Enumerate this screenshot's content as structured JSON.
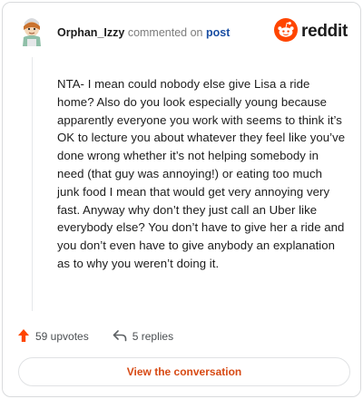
{
  "header": {
    "username": "Orphan_Izzy",
    "action_text": "commented on",
    "post_link": "post",
    "brand_word": "reddit"
  },
  "comment": {
    "text": "NTA- I mean could nobody else give Lisa a ride home? Also do you look especially young because apparently everyone you work with seems to think it’s OK to lecture you about whatever they feel like you’ve done wrong whether it’s not helping somebody in need (that guy was annoying!) or eating too much junk food I mean that would get very annoying very fast. Anyway why don’t they just call an Uber like everybody else? You don’t have to give her a ride and you don’t even have to give anybody an explanation as to why you weren’t doing it."
  },
  "footer": {
    "upvotes_label": "59 upvotes",
    "replies_label": "5 replies",
    "cta_label": "View the conversation"
  },
  "colors": {
    "brand_orange": "#ff4500",
    "link_blue": "#1a4ea3",
    "cta_orange": "#d74a14"
  },
  "icons": {
    "upvote": "upvote-arrow-icon",
    "reply": "reply-arrow-icon",
    "brand": "reddit-alien-icon",
    "avatar": "user-avatar"
  }
}
